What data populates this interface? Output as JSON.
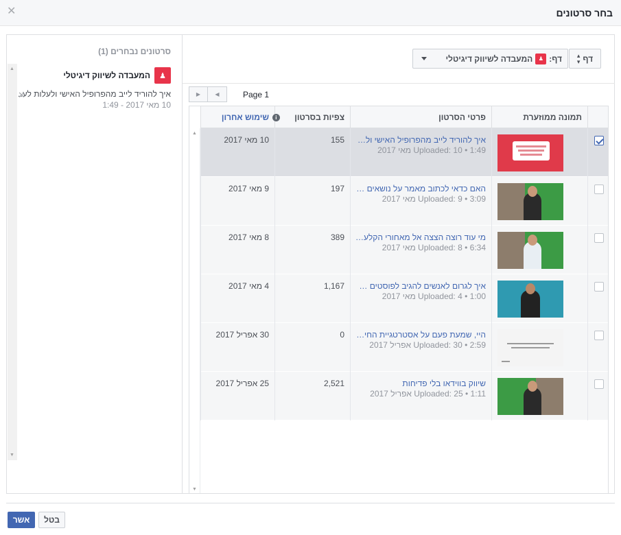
{
  "dialog": {
    "title": "בחר סרטונים",
    "close_glyph": "✕"
  },
  "selected_panel": {
    "title": "סרטונים נבחרים (1)",
    "page_name": "המעבדה לשיווק דיגיטלי",
    "item_title": "איך להוריד לייב מהפרופיל האישי ולעלות לע..",
    "item_sub": "10 מאי 2017 - 1:49",
    "remove_glyph": "✕"
  },
  "filter": {
    "dp_label": "דף",
    "page_select_label": "דף:",
    "page_select_value": "המעבדה לשיווק דיגיטלי"
  },
  "pager": {
    "label": "Page 1",
    "prev_glyph": "◀",
    "next_glyph": "▶"
  },
  "table": {
    "columns": {
      "thumbnail": "תמונה ממוזערת",
      "details": "פרטי הסרטון",
      "views": "צפיות בסרטון",
      "last_used": "שימוש אחרון"
    },
    "info_glyph": "i",
    "rows": [
      {
        "checked": true,
        "title": "איך להוריד לייב מהפרופיל האישי ולעלות לעמוד",
        "sub": "1:49 • Uploaded: 10 מאי 2017",
        "views": "155",
        "date": "10 מאי 2017",
        "thumb": "red-quote-icon"
      },
      {
        "checked": false,
        "title": "האם כדאי לכתוב מאמר על נושאים של אחרים",
        "sub": "3:09 • Uploaded: 9 מאי 2017",
        "views": "197",
        "date": "9 מאי 2017",
        "thumb": "video-green-icon"
      },
      {
        "checked": false,
        "title": "מי עוד רוצה הצצה אל מאחורי הקלעים של",
        "sub": "6:34 • Uploaded: 8 מאי 2017",
        "views": "389",
        "date": "8 מאי 2017",
        "thumb": "video-green-white-icon"
      },
      {
        "checked": false,
        "title": "איך לגרום לאנשים להגיב לפוסטים שלכם",
        "sub": "1:00 • Uploaded: 4 מאי 2017",
        "views": "1,167",
        "date": "4 מאי 2017",
        "thumb": "video-blue-icon"
      },
      {
        "checked": false,
        "title": "היי, שמעת פעם על אסטרטגיית החיתוך",
        "sub": "2:59 • Uploaded: 30 אפריל 2017",
        "views": "0",
        "date": "30 אפריל 2017",
        "thumb": "document-icon"
      },
      {
        "checked": false,
        "title": "שיווק בווידאו בלי פדיחות",
        "sub": "1:11 • Uploaded: 25 אפריל 2017",
        "views": "2,521",
        "date": "25 אפריל 2017",
        "thumb": "video-green-icon"
      }
    ]
  },
  "footer": {
    "confirm_label": "אשר",
    "cancel_label": "בטל"
  },
  "colors": {
    "accent": "#4267b2",
    "brand_red": "#e8344a",
    "selected_row": "#dcdee3"
  }
}
